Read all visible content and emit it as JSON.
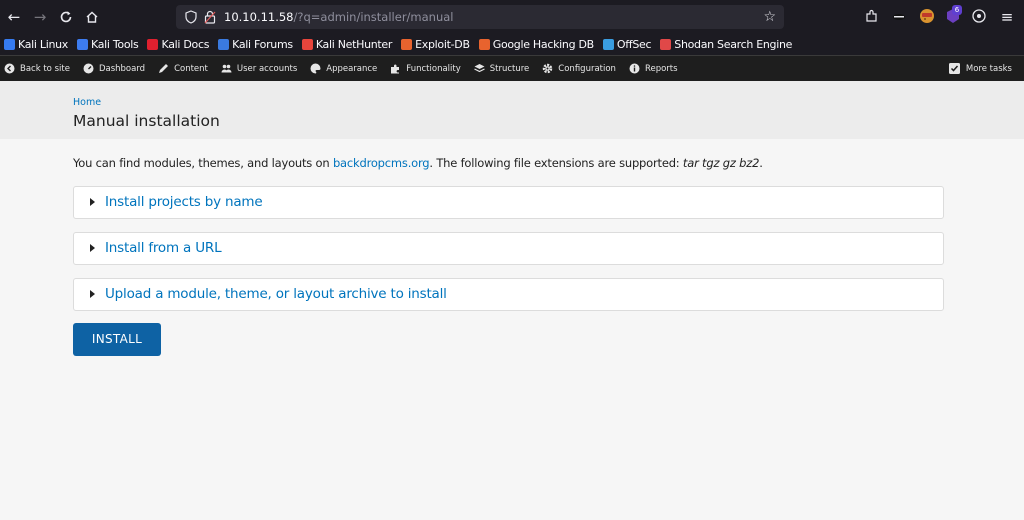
{
  "browser": {
    "url_host": "10.10.11.58",
    "url_path": "/?q=admin/installer/manual",
    "extension_badge": "6"
  },
  "bookmarks": [
    {
      "label": "Kali Linux",
      "icon": "kali-dragon-icon",
      "color": "#367bf0"
    },
    {
      "label": "Kali Tools",
      "icon": "kali-tools-icon",
      "color": "#3d7cf0"
    },
    {
      "label": "Kali Docs",
      "icon": "kali-docs-icon",
      "color": "#e0202f"
    },
    {
      "label": "Kali Forums",
      "icon": "kali-forums-icon",
      "color": "#3a7ae0"
    },
    {
      "label": "Kali NetHunter",
      "icon": "nethunter-icon",
      "color": "#e8453c"
    },
    {
      "label": "Exploit-DB",
      "icon": "exploit-db-icon",
      "color": "#e8632e"
    },
    {
      "label": "Google Hacking DB",
      "icon": "ghdb-icon",
      "color": "#e8632e"
    },
    {
      "label": "OffSec",
      "icon": "offsec-icon",
      "color": "#3a9de0"
    },
    {
      "label": "Shodan Search Engine",
      "icon": "shodan-icon",
      "color": "#e04848"
    }
  ],
  "admin_bar": {
    "items": [
      {
        "label": "Back to site",
        "icon": "back-arrow-icon"
      },
      {
        "label": "Dashboard",
        "icon": "dashboard-icon"
      },
      {
        "label": "Content",
        "icon": "pencil-icon"
      },
      {
        "label": "User accounts",
        "icon": "users-icon"
      },
      {
        "label": "Appearance",
        "icon": "palette-icon"
      },
      {
        "label": "Functionality",
        "icon": "puzzle-icon"
      },
      {
        "label": "Structure",
        "icon": "layers-icon"
      },
      {
        "label": "Configuration",
        "icon": "gear-icon"
      },
      {
        "label": "Reports",
        "icon": "info-icon"
      }
    ],
    "more_tasks": "More tasks"
  },
  "header": {
    "breadcrumb": "Home",
    "title": "Manual installation"
  },
  "intro": {
    "before_link": "You can find modules, themes, and layouts on ",
    "link": "backdropcms.org",
    "after_link": ". The following file extensions are supported: ",
    "extensions": "tar tgz gz bz2",
    "end": "."
  },
  "fieldsets": [
    {
      "label": "Install projects by name",
      "expanded": false
    },
    {
      "label": "Install from a URL",
      "expanded": false
    },
    {
      "label": "Upload a module, theme, or layout archive to install",
      "expanded": false
    }
  ],
  "actions": {
    "install_label": "INSTALL"
  },
  "colors": {
    "link": "#0074bd",
    "button": "#0e62a4",
    "admin_bar": "#1e1e1e",
    "browser_chrome": "#1c1b22"
  }
}
